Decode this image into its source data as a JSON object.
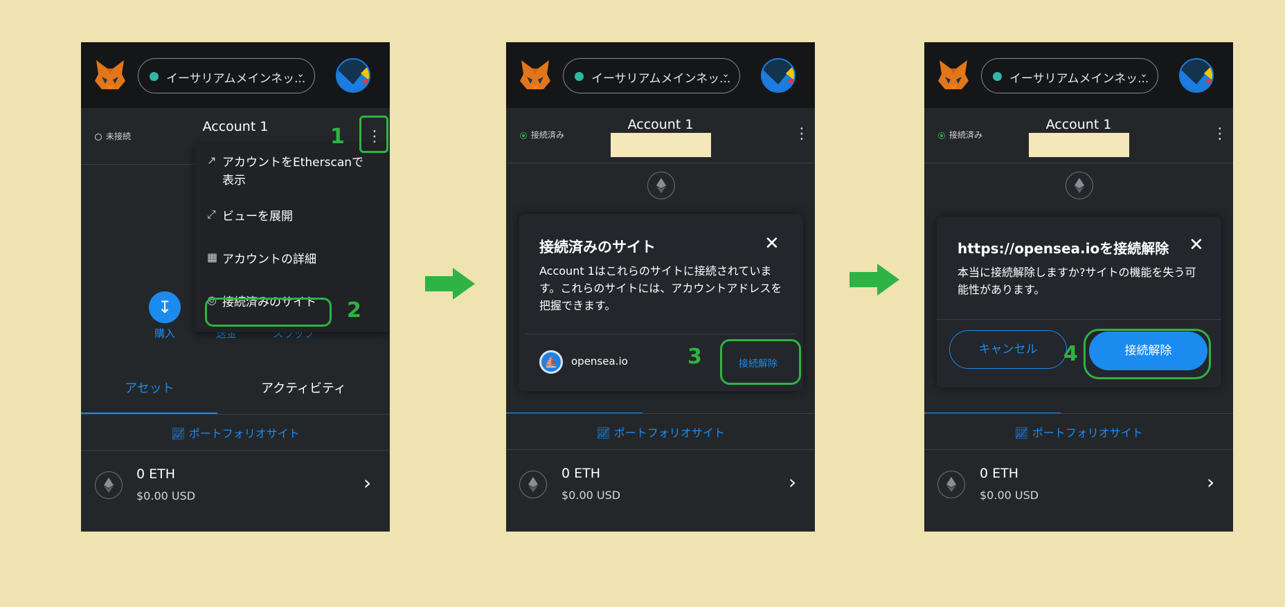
{
  "network": {
    "label": "イーサリアムメインネッ..."
  },
  "account": {
    "name": "Account 1"
  },
  "status": {
    "disconnected": "未接続",
    "connected": "接続済み"
  },
  "menu": {
    "items": [
      {
        "label": "アカウントをEtherscanで表示"
      },
      {
        "label": "ビューを展開"
      },
      {
        "label": "アカウントの詳細"
      },
      {
        "label": "接続済みのサイト"
      }
    ]
  },
  "actions": {
    "buy": "購入",
    "send": "送金",
    "swap": "スワップ"
  },
  "tabs": {
    "assets": "アセット",
    "activity": "アクティビティ"
  },
  "portfolio": {
    "label": "ポートフォリオサイト"
  },
  "asset": {
    "amount": "0 ETH",
    "fiat": "$0.00 USD"
  },
  "connected_sites_modal": {
    "title": "接続済みのサイト",
    "body": "Account 1はこれらのサイトに接続されています。これらのサイトには、アカウントアドレスを把握できます。",
    "site": "opensea.io",
    "disconnect": "接続解除"
  },
  "disconnect_modal": {
    "title": "https://opensea.ioを接続解除",
    "body": "本当に接続解除しますか?サイトの機能を失う可能性があります。",
    "cancel": "キャンセル",
    "confirm": "接続解除"
  },
  "steps": [
    "1",
    "2",
    "3",
    "4"
  ],
  "colors": {
    "background": "#efe3b1",
    "panel": "#24272a",
    "accent_blue": "#1b8bf0",
    "highlight_green": "#2fb344"
  }
}
